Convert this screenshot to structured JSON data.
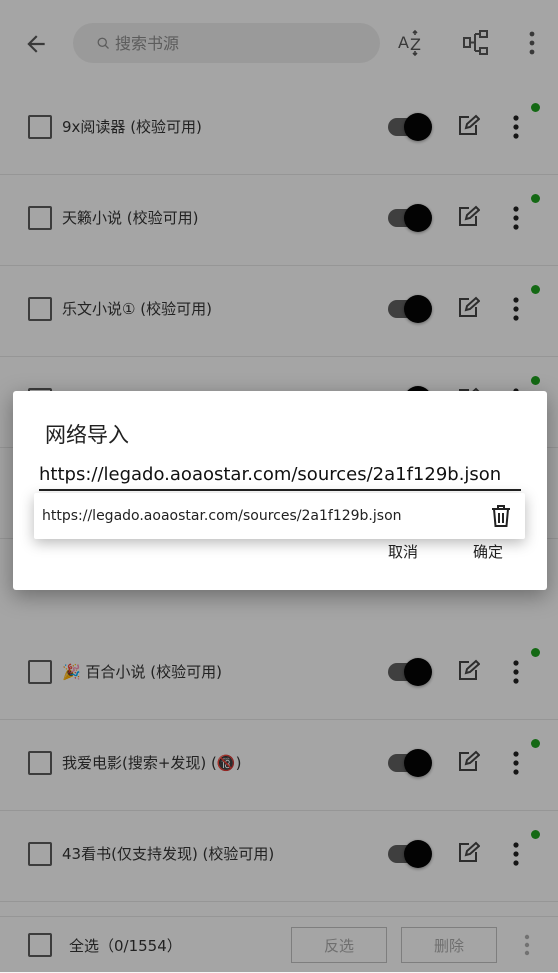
{
  "toolbar": {
    "search_placeholder": "搜索书源"
  },
  "sources": [
    {
      "name": "9x阅读器 (校验可用)",
      "enabled": true,
      "has_dot": true
    },
    {
      "name": "天籁小说 (校验可用)",
      "enabled": true,
      "has_dot": true
    },
    {
      "name": "乐文小说① (校验可用)",
      "enabled": true,
      "has_dot": true
    },
    {
      "name": "",
      "enabled": true,
      "has_dot": true
    },
    {
      "name": "",
      "enabled": true,
      "has_dot": true
    },
    {
      "name": "🎉 百合小说 (校验可用)",
      "enabled": true,
      "has_dot": true
    },
    {
      "name": "我爱电影(搜索+发现) (🔞)",
      "enabled": true,
      "has_dot": true
    },
    {
      "name": "43看书(仅支持发现)  (校验可用)",
      "enabled": true,
      "has_dot": true
    }
  ],
  "bottom": {
    "select_all_label": "全选（0/1554）",
    "invert_label": "反选",
    "delete_label": "删除"
  },
  "dialog": {
    "title": "网络导入",
    "url_value": "https://legado.aoaostar.com/sources/2a1f129b.json",
    "suggestion": "https://legado.aoaostar.com/sources/2a1f129b.json",
    "cancel_label": "取消",
    "ok_label": "确定"
  },
  "colors": {
    "accent_dot": "#1f9d1f",
    "switch_knob": "#050505",
    "scrim": "rgba(0,0,0,0.33)"
  },
  "icons": {
    "back": "arrow-left-icon",
    "search": "search-icon",
    "sort": "sort-az-icon",
    "group": "group-icon",
    "more": "more-vert-icon",
    "edit": "edit-icon",
    "delete": "trash-icon"
  }
}
